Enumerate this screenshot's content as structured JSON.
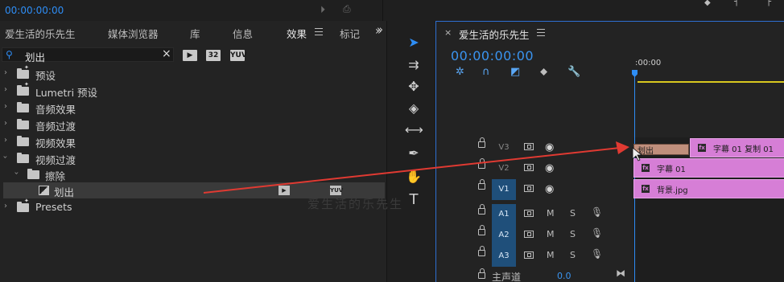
{
  "top": {
    "timecode": "00:00:00:00"
  },
  "effects_panel": {
    "tabs": [
      "爱生活的乐先生",
      "媒体浏览器",
      "库",
      "信息",
      "效果",
      "标记"
    ],
    "active_tab": "效果",
    "search": {
      "value": "划出"
    },
    "filter_badges": [
      "32",
      "YUV"
    ],
    "tree": [
      {
        "label": "预设",
        "level": 0,
        "expanded": false,
        "icon": "folder-star-icon"
      },
      {
        "label": "Lumetri 预设",
        "level": 0,
        "expanded": false,
        "icon": "folder-star-icon"
      },
      {
        "label": "音频效果",
        "level": 0,
        "expanded": false,
        "icon": "folder-icon"
      },
      {
        "label": "音频过渡",
        "level": 0,
        "expanded": false,
        "icon": "folder-icon"
      },
      {
        "label": "视频效果",
        "level": 0,
        "expanded": false,
        "icon": "folder-icon"
      },
      {
        "label": "视频过渡",
        "level": 0,
        "expanded": true,
        "icon": "folder-icon"
      },
      {
        "label": "擦除",
        "level": 1,
        "expanded": true,
        "icon": "folder-icon"
      },
      {
        "label": "划出",
        "level": 2,
        "selected": true,
        "icon": "transition-effect-icon",
        "badges": [
          "",
          "YUV"
        ]
      },
      {
        "label": "Presets",
        "level": 0,
        "expanded": false,
        "icon": "folder-star-icon"
      }
    ]
  },
  "tools": [
    "selection-tool-icon",
    "track-select-tool-icon",
    "ripple-edit-tool-icon",
    "razor-tool-icon",
    "slip-tool-icon",
    "pen-tool-icon",
    "hand-tool-icon",
    "type-tool-icon"
  ],
  "timeline": {
    "sequence_title": "爱生活的乐先生",
    "timecode": "00:00:00:00",
    "ruler_label": ":00:00",
    "video_tracks": [
      {
        "name": "V3",
        "active": false
      },
      {
        "name": "V2",
        "active": false
      },
      {
        "name": "V1",
        "active": true
      }
    ],
    "audio_tracks": [
      {
        "name": "A1",
        "active": true,
        "m": "M",
        "s": "S"
      },
      {
        "name": "A2",
        "active": true,
        "m": "M",
        "s": "S"
      },
      {
        "name": "A3",
        "active": true,
        "m": "M",
        "s": "S"
      }
    ],
    "clips": [
      {
        "track": "V3",
        "label": "字幕 01 复制 01"
      },
      {
        "track": "V2",
        "label": "字幕 01"
      },
      {
        "track": "V1",
        "label": "背景.jpg"
      }
    ],
    "transition_label": "划出",
    "master": {
      "label": "主声道",
      "value": "0.0"
    }
  },
  "watermark": "爱生活的乐先生",
  "colors": {
    "accent": "#2e8df5",
    "clip": "#d67ed6",
    "transition": "#c08f7c",
    "arrow": "#e03a32",
    "work_bar": "#d8c81f"
  }
}
